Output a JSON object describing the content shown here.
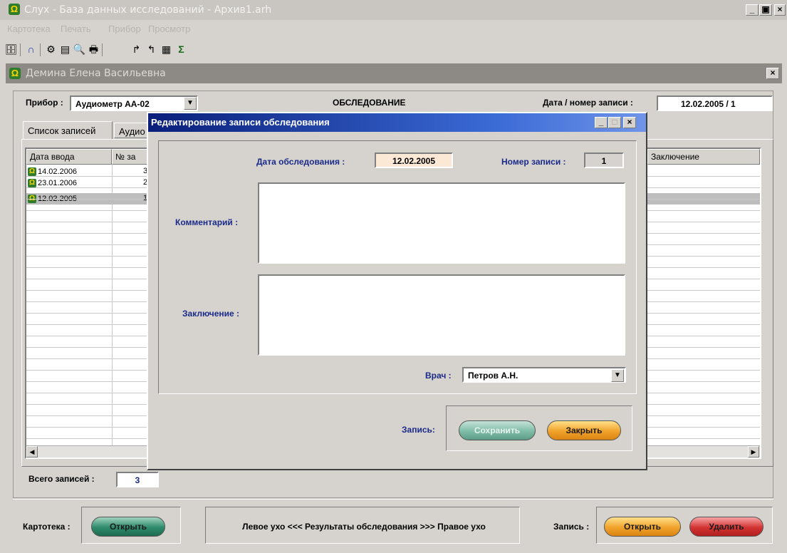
{
  "window": {
    "title": "Слух -  База данных исследований - Архив1.arh",
    "app_icon": "headphones-icon",
    "minimize": "_",
    "maximize": "▣",
    "close": "×"
  },
  "menu": [
    "Картотека",
    "Печать",
    "Прибор",
    "Просмотр"
  ],
  "toolbar_icons": [
    "open-db-icon",
    "headphones-icon",
    "settings-icon",
    "card-icon",
    "preview-icon",
    "print-icon",
    "export-icon",
    "import-icon",
    "table-icon",
    "sum-icon"
  ],
  "child_window": {
    "title": "Демина Елена Васильевна",
    "close": "×"
  },
  "main": {
    "device_label": "Прибор :",
    "device_value": "Аудиометр АА-02",
    "section_title": "ОБСЛЕДОВАНИЕ",
    "date_label": "Дата / номер записи :",
    "date_value": "12.02.2005 / 1",
    "tabs": [
      "Список записей",
      "Аудио"
    ],
    "grid": {
      "col_date": "Дата ввода",
      "col_num": "№ за",
      "col_conclusion": "Заключение",
      "rows": [
        {
          "date": "14.02.2006",
          "num": "3"
        },
        {
          "date": "23.01.2006",
          "num": "2"
        },
        {
          "date": "12.02.2005",
          "num": "1"
        }
      ]
    },
    "total_label": "Всего записей :",
    "total_value": "3"
  },
  "footer": {
    "card_label": "Картотека :",
    "open_card": "Открыть",
    "results_text": "Левое ухо <<< Результаты обследования >>> Правое ухо",
    "record_label": "Запись :",
    "open_record": "Открыть",
    "delete_record": "Удалить"
  },
  "dialog": {
    "title": "Редактирование записи обследования",
    "exam_date_label": "Дата обследования :",
    "exam_date_value": "12.02.2005",
    "record_num_label": "Номер записи :",
    "record_num_value": "1",
    "comment_label": "Комментарий :",
    "comment_value": "",
    "conclusion_label": "Заключение :",
    "conclusion_value": "",
    "doctor_label": "Врач :",
    "doctor_value": "Петров А.Н.",
    "record_label": "Запись:",
    "save": "Сохранить",
    "close": "Закрыть"
  }
}
